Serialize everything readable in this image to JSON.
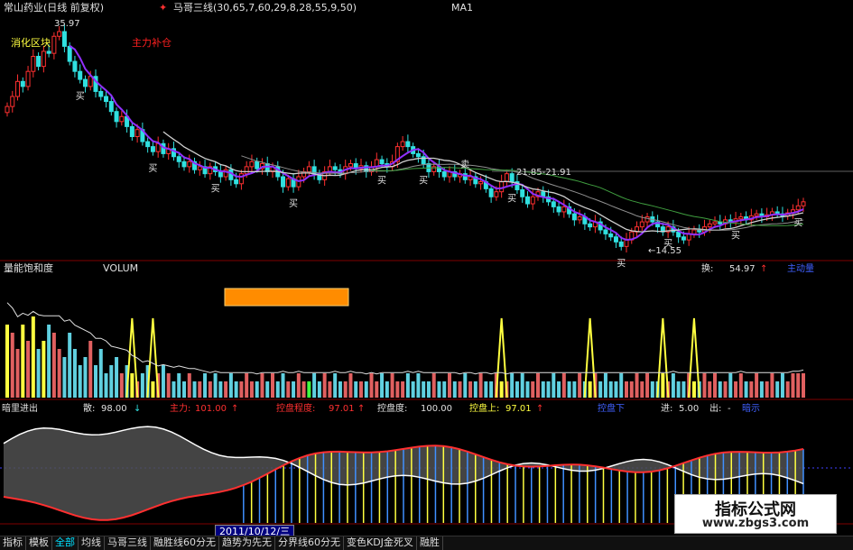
{
  "colors": {
    "up": "#ff3030",
    "down": "#30e0e0",
    "ma_purple": "#9030ff",
    "ma_white": "#d0d0d0",
    "ma_gray": "#909090",
    "ma_green": "#40a040",
    "yellow": "#ffff40",
    "orange": "#ff8000",
    "blue_label": "#4060ff"
  },
  "main_panel": {
    "title": "常山药业(日线 前复权)",
    "indicator": "马哥三线(30,65,7,60,29,8,28,55,9,50)",
    "ma_label": "MA1",
    "high_price": "35.97",
    "left_note": "消化区块",
    "red_note": "主力补仓",
    "range_label": "21.85-21.91",
    "low_label": "←14.55",
    "signals": [
      "买",
      "买",
      "买",
      "买",
      "买",
      "买",
      "卖",
      "买",
      "买",
      "买",
      "买",
      "买"
    ]
  },
  "volume_panel": {
    "name": "量能饱和度",
    "sub": "VOLUM",
    "turnover_label": "换:",
    "turnover_value": "54.97",
    "turnover_arrow": "↑",
    "right_tag": "主动量"
  },
  "bottom_panel": {
    "name": "暗里进出",
    "san_label": "散:",
    "san_value": "98.00",
    "san_arrow": "↓",
    "zhuli_label": "主力:",
    "zhuli_value": "101.00",
    "zhuli_arrow": "↑",
    "kongpan_label": "控盘程度:",
    "kongpan_value": "97.01",
    "kongpan_arrow": "↑",
    "kongpandu_label": "控盘度:",
    "kongpandu_value": "100.00",
    "kongpanshang_label": "控盘上:",
    "kongpanshang_value": "97.01",
    "kongpanshang_arrow": "↑",
    "kongpanxia_label": "控盘下",
    "jin_label": "进:",
    "jin_value": "5.00",
    "chu_label": "出:",
    "chu_value": "-",
    "end_label": "暗示"
  },
  "cursor_date": "2011/10/12/三",
  "bottom_tabs": [
    "指标",
    "模板",
    "全部",
    "均线",
    "马哥三线",
    "融胜线60分无",
    "趋势为先无",
    "分界线60分无",
    "变色KDJ金死叉",
    "融胜"
  ],
  "watermark": {
    "main": "指标公式网",
    "sub": "www.zbgs3.com"
  },
  "chart_data": {
    "type": "candlestick",
    "series": [
      {
        "name": "price",
        "values": [
          28.5,
          29.5,
          31.0,
          30.5,
          32.0,
          33.5,
          32.5,
          34.0,
          33.8,
          35.5,
          35.97,
          34.5,
          33.0,
          32.0,
          31.2,
          30.5,
          31.5,
          30.0,
          29.5,
          29.0,
          28.0,
          27.0,
          27.5,
          26.5,
          25.5,
          26.2,
          25.0,
          24.5,
          24.0,
          24.8,
          23.8,
          24.3,
          23.5,
          23.0,
          22.5,
          23.0,
          22.2,
          22.5,
          21.8,
          22.5,
          22.0,
          21.5,
          22.2,
          21.2,
          20.8,
          21.8,
          22.5,
          23.0,
          22.3,
          22.8,
          22.0,
          22.5,
          21.5,
          20.5,
          21.3,
          20.5,
          21.5,
          22.0,
          22.5,
          21.8,
          21.2,
          22.0,
          22.5,
          22.2,
          21.8,
          22.5,
          22.8,
          22.3,
          22.6,
          22.0,
          22.5,
          23.2,
          22.8,
          22.5,
          23.0,
          24.5,
          25.0,
          24.5,
          23.8,
          23.5,
          22.8,
          22.0,
          22.5,
          22.0,
          21.5,
          22.0,
          21.5,
          21.8,
          21.2,
          21.5,
          20.8,
          21.0,
          20.3,
          19.5,
          20.0,
          21.0,
          21.8,
          21.0,
          20.2,
          19.5,
          18.8,
          19.5,
          20.0,
          19.5,
          19.0,
          18.5,
          18.0,
          18.5,
          17.8,
          17.2,
          17.5,
          16.8,
          16.5,
          17.0,
          16.2,
          15.8,
          15.5,
          15.0,
          14.55,
          15.2,
          16.0,
          16.5,
          17.0,
          17.5,
          17.0,
          16.5,
          16.0,
          16.5,
          16.0,
          15.5,
          15.2,
          15.8,
          16.2,
          16.0,
          16.5,
          16.8,
          17.0,
          16.8,
          17.2,
          17.0,
          17.3,
          17.5,
          17.2,
          17.6,
          17.8,
          17.5,
          17.7,
          18.0,
          17.8,
          17.6,
          17.9,
          18.2,
          18.6,
          19.0
        ]
      },
      {
        "name": "volume",
        "values": [
          9,
          8,
          6,
          9,
          7,
          10,
          6,
          7,
          9,
          8,
          6,
          5,
          8,
          6,
          4,
          5,
          7,
          4,
          6,
          3,
          4,
          5,
          3,
          4,
          3,
          2,
          3,
          4,
          2,
          3,
          4,
          3,
          2,
          3,
          2,
          3,
          2,
          2,
          3,
          2,
          3,
          2,
          2,
          3,
          2,
          2,
          3,
          2,
          2,
          3,
          2,
          3,
          2,
          3,
          2,
          2,
          3,
          2,
          2,
          3,
          2,
          3,
          2,
          3,
          2,
          2,
          3,
          2,
          2,
          2,
          3,
          2,
          3,
          2,
          3,
          2,
          2,
          3,
          2,
          3,
          2,
          2,
          3,
          2,
          2,
          3,
          2,
          2,
          3,
          2,
          2,
          3,
          2,
          2,
          3,
          2,
          2,
          3,
          2,
          3,
          2,
          2,
          3,
          2,
          2,
          3,
          2,
          3,
          2,
          2,
          3,
          2,
          2,
          3,
          2,
          3,
          2,
          2,
          3,
          2,
          2,
          3,
          2,
          3,
          2,
          2,
          3,
          2,
          3,
          2,
          2,
          3,
          2,
          2,
          3,
          2,
          3,
          2,
          2,
          3,
          2,
          3,
          2,
          2,
          3,
          2,
          2,
          3,
          2,
          3,
          2,
          3,
          3,
          3,
          2,
          2
        ]
      }
    ]
  }
}
